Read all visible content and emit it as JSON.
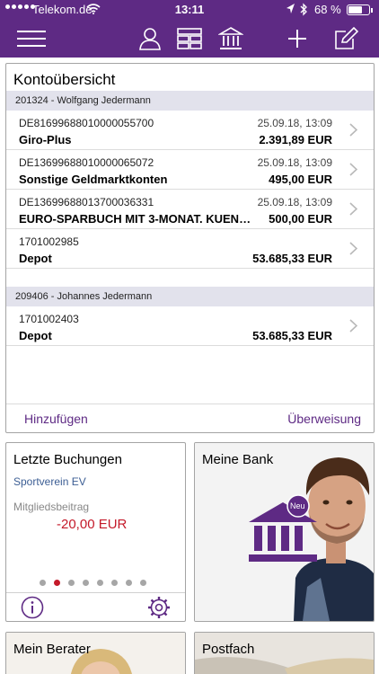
{
  "status": {
    "carrier": "Telekom.de",
    "time": "13:11",
    "battery_pct_label": "68 %",
    "battery_level": 0.68
  },
  "nav": {
    "icons": [
      "menu-icon",
      "user-icon",
      "accounts-grid-icon",
      "bank-icon",
      "plus-icon",
      "compose-icon"
    ]
  },
  "overview": {
    "title": "Kontoübersicht",
    "groups": [
      {
        "header": "201324 - Wolfgang Jedermann",
        "rows": [
          {
            "iban_prefix": "DE81699688010",
            "iban_rest": "000055700",
            "date": "25.09.18, 13:09",
            "name": "Giro-Plus",
            "amount": "2.391,89 EUR"
          },
          {
            "iban_prefix": "DE13699688010",
            "iban_rest": "000065072",
            "date": "25.09.18, 13:09",
            "name": "Sonstige Geldmarktkonten",
            "amount": "495,00 EUR"
          },
          {
            "iban_prefix": "DE13699688013",
            "iban_rest": "700036331",
            "date": "25.09.18, 13:09",
            "name": "EURO-SPARBUCH MIT 3-MONAT. KUEN…",
            "amount": "500,00 EUR"
          },
          {
            "iban_prefix": "1701002985",
            "iban_rest": "",
            "date": "",
            "name": "Depot",
            "amount": "53.685,33 EUR"
          }
        ]
      },
      {
        "header": "209406 - Johannes Jedermann",
        "rows": [
          {
            "iban_prefix": "1701002403",
            "iban_rest": "",
            "date": "",
            "name": "Depot",
            "amount": "53.685,33 EUR"
          }
        ]
      }
    ],
    "add_label": "Hinzufügen",
    "transfer_label": "Überweisung"
  },
  "tiles": {
    "buchungen": {
      "title": "Letzte Buchungen",
      "counterparty": "Sportverein EV",
      "description": "Mitgliedsbeitrag",
      "amount": "-20,00 EUR",
      "page_count": 8,
      "active_page": 1
    },
    "bank": {
      "title": "Meine Bank",
      "badge": "Neu"
    },
    "berater": {
      "title": "Mein Berater"
    },
    "postfach": {
      "title": "Postfach"
    }
  },
  "colors": {
    "brand": "#5e2a84",
    "negative": "#c41a2a",
    "link": "#3c5e94"
  }
}
